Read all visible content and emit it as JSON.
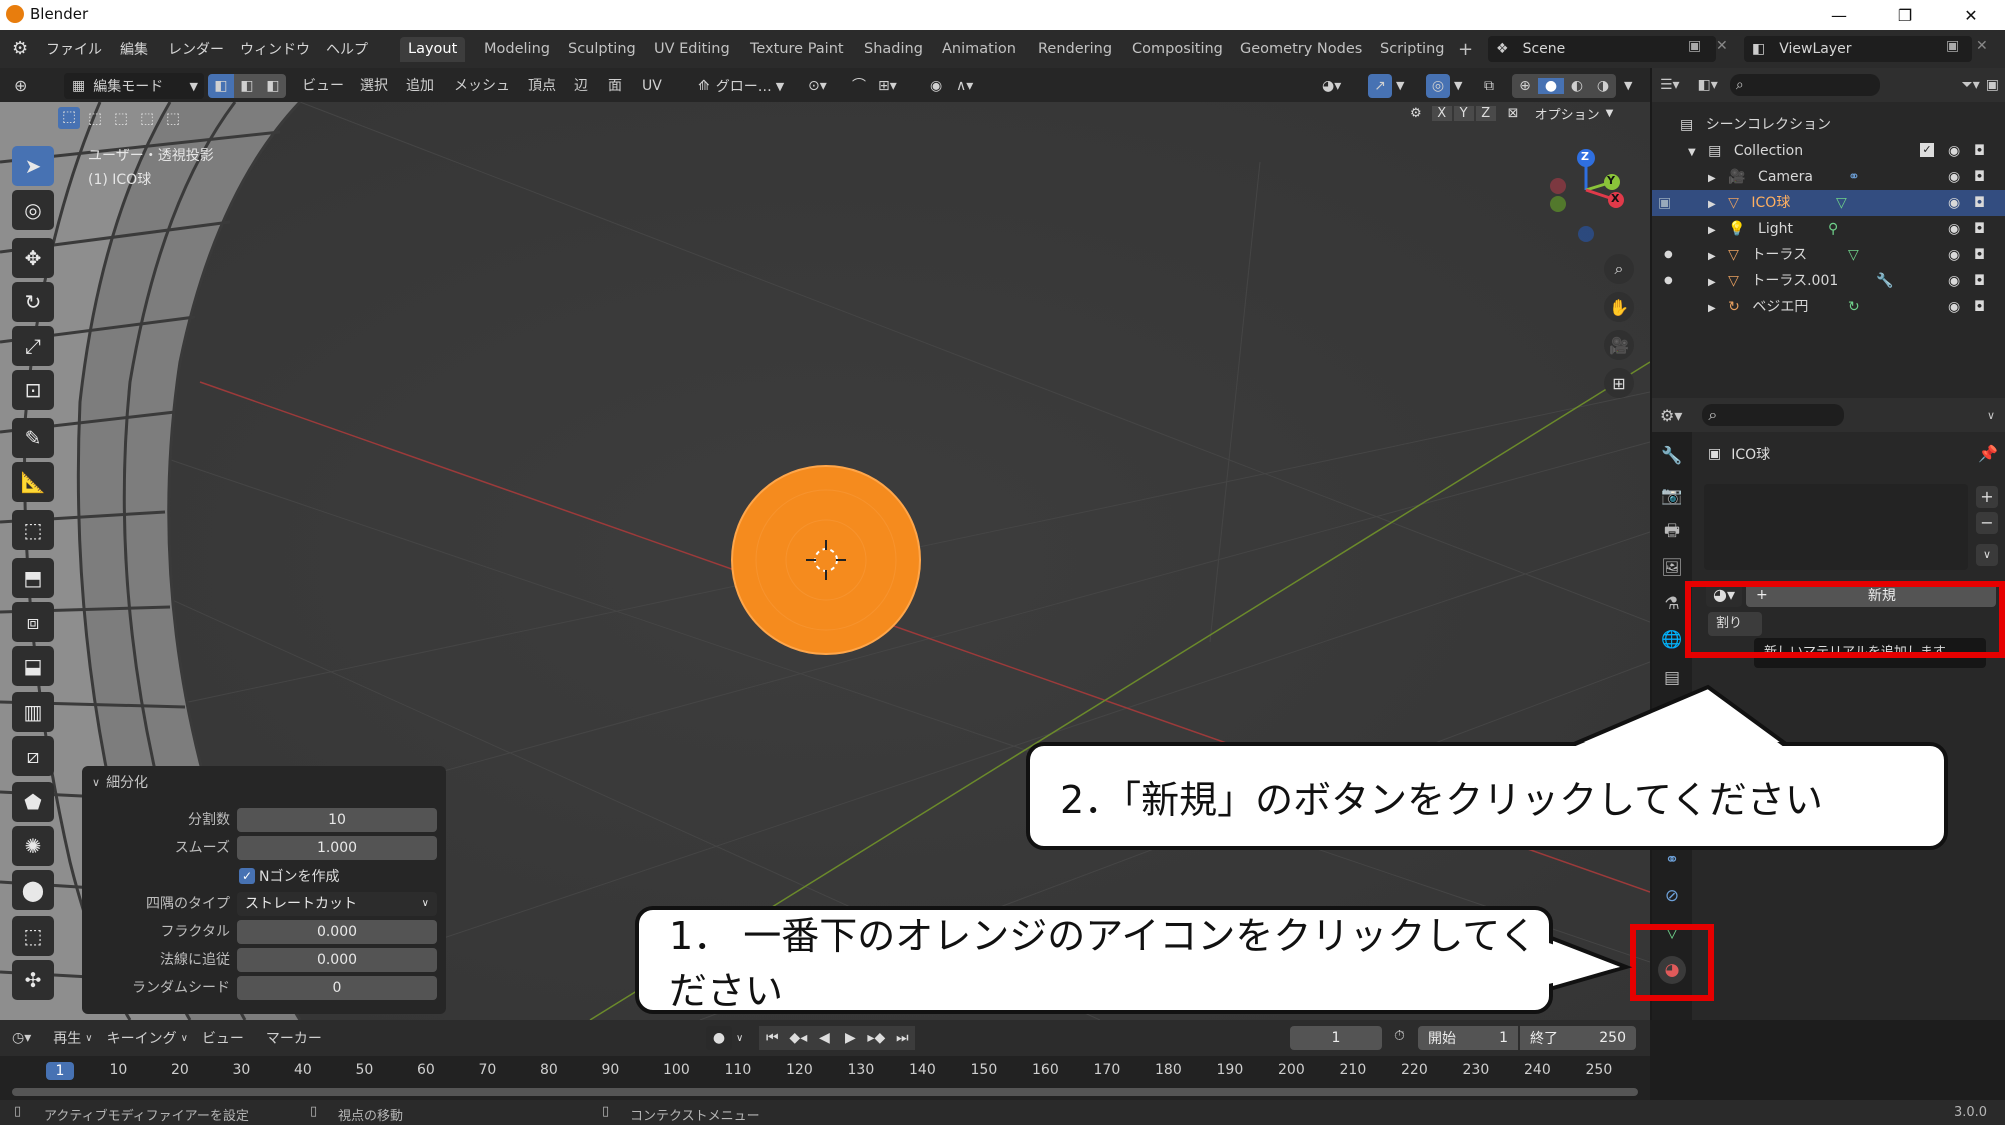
{
  "window": {
    "app_title": "Blender",
    "version": "3.0.0"
  },
  "menu": [
    "ファイル",
    "編集",
    "レンダー",
    "ウィンドウ",
    "ヘルプ"
  ],
  "workspaces": [
    "Layout",
    "Modeling",
    "Sculpting",
    "UV Editing",
    "Texture Paint",
    "Shading",
    "Animation",
    "Rendering",
    "Compositing",
    "Geometry Nodes",
    "Scripting"
  ],
  "workspace_add": "+",
  "scene": "Scene",
  "view_layer": "ViewLayer",
  "header3d": {
    "mode": "編集モード",
    "menus": [
      "ビュー",
      "選択",
      "追加",
      "メッシュ",
      "頂点",
      "辺",
      "面",
      "UV"
    ],
    "transform_orientation": "グロー…",
    "options": "オプション",
    "axes": [
      "X",
      "Y",
      "Z"
    ]
  },
  "viewport": {
    "view_name": "ユーザー・透視投影",
    "object_label": "(1) ICO球",
    "sphere_color": "#f58b1e",
    "gizmo": {
      "z": "Z",
      "y": "Y",
      "x": "X"
    }
  },
  "operator_panel": {
    "title": "細分化",
    "fields": [
      {
        "label": "分割数",
        "value": "10"
      },
      {
        "label": "スムーズ",
        "value": "1.000"
      }
    ],
    "checkbox_label": "Nゴンを作成",
    "checkbox_checked": true,
    "corner_label": "四隅のタイプ",
    "corner_value": "ストレートカット",
    "fields2": [
      {
        "label": "フラクタル",
        "value": "0.000"
      },
      {
        "label": "法線に追従",
        "value": "0.000"
      },
      {
        "label": "ランダムシード",
        "value": "0"
      }
    ]
  },
  "outliner": {
    "root": "シーンコレクション",
    "collection": "Collection",
    "items": [
      "Camera",
      "ICO球",
      "Light",
      "トーラス",
      "トーラス.001",
      "ベジエ円"
    ],
    "selected_index": 1
  },
  "properties": {
    "object_name": "ICO球",
    "new_button": "新規",
    "assign_label": "割り",
    "tooltip": "新しいマテリアルを追加します."
  },
  "timeline": {
    "menus": [
      "再生",
      "キーイング",
      "ビュー",
      "マーカー"
    ],
    "current_frame": "1",
    "start_label": "開始",
    "start": "1",
    "end_label": "終了",
    "end": "250",
    "ruler": [
      "1",
      "10",
      "20",
      "30",
      "40",
      "50",
      "60",
      "70",
      "80",
      "90",
      "100",
      "110",
      "120",
      "130",
      "140",
      "150",
      "160",
      "170",
      "180",
      "190",
      "200",
      "210",
      "220",
      "230",
      "240",
      "250"
    ]
  },
  "status": {
    "left": "アクティブモディファイアーを設定",
    "middle": "視点の移動",
    "right": "コンテクストメニュー"
  },
  "annotations": {
    "step1": "1． 一番下のオレンジのアイコンをクリックしてください",
    "step2": "2．「新規」のボタンをクリックしてください",
    "highlight_color": "#e60000"
  }
}
